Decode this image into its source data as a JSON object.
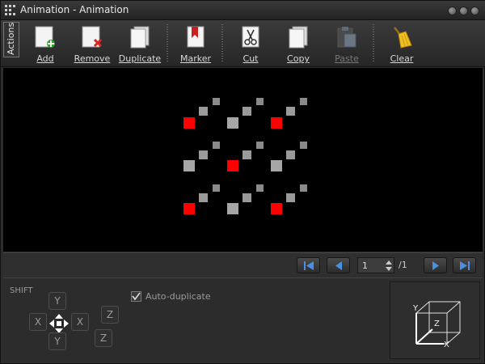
{
  "window": {
    "title": "Animation - Animation"
  },
  "toolbar": {
    "actions_tab": "Actions",
    "buttons": [
      {
        "id": "add",
        "label": "Add",
        "icon": "add-page-icon",
        "enabled": true
      },
      {
        "id": "remove",
        "label": "Remove",
        "icon": "remove-page-icon",
        "enabled": true
      },
      {
        "id": "duplicate",
        "label": "Duplicate",
        "icon": "duplicate-pages-icon",
        "enabled": true
      },
      {
        "id": "marker",
        "label": "Marker",
        "icon": "bookmark-icon",
        "enabled": true
      },
      {
        "id": "cut",
        "label": "Cut",
        "icon": "scissors-icon",
        "enabled": true
      },
      {
        "id": "copy",
        "label": "Copy",
        "icon": "copy-icon",
        "enabled": true
      },
      {
        "id": "paste",
        "label": "Paste",
        "icon": "paste-icon",
        "enabled": false
      },
      {
        "id": "clear",
        "label": "Clear",
        "icon": "broom-icon",
        "enabled": true
      }
    ]
  },
  "canvas": {
    "background": "#000000",
    "colors": {
      "highlight": "#ff0000",
      "front": "#a6a6a6",
      "back": "#8a8a8a"
    },
    "red_cells": [
      "row1-left",
      "row1-right",
      "row2-middle",
      "row3-left",
      "row3-right"
    ]
  },
  "playback": {
    "current_frame": "1",
    "total_frames": "/1",
    "buttons": [
      "first-frame-icon",
      "previous-frame-icon",
      "next-frame-icon",
      "last-frame-icon"
    ],
    "accent": "#4a8fe0"
  },
  "shift": {
    "label": "SHIFT",
    "y_up": "Y",
    "y_down": "Y",
    "x_left": "X",
    "x_right": "X",
    "z_up": "Z",
    "z_down": "Z"
  },
  "auto_duplicate": {
    "label": "Auto-duplicate",
    "checked": true
  },
  "axis_preview": {
    "x": "X",
    "y": "Y",
    "z": "Z"
  }
}
